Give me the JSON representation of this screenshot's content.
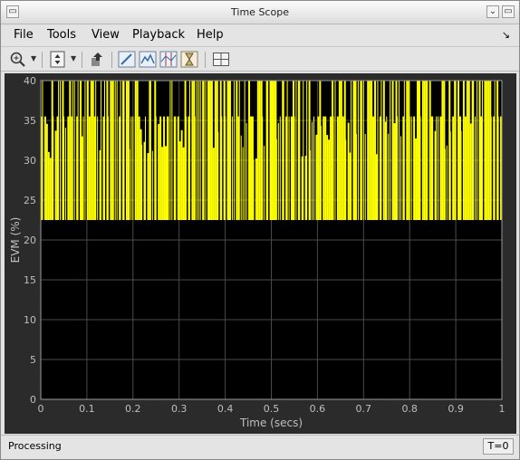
{
  "window": {
    "title": "Time Scope"
  },
  "menu": {
    "file": "File",
    "tools": "Tools",
    "view": "View",
    "playback": "Playback",
    "help": "Help"
  },
  "status": {
    "left": "Processing",
    "time": "T=0"
  },
  "colors": {
    "plot_bg": "#000000",
    "figure_bg": "#2b2b2b",
    "trace": "#ffff00",
    "grid": "#4a4a4a",
    "tick_text": "#bfbfbf"
  },
  "chart_data": {
    "type": "line",
    "title": "",
    "xlabel": "Time (secs)",
    "ylabel": "EVM (%)",
    "xlim": [
      0,
      1
    ],
    "ylim": [
      0,
      40
    ],
    "xticks": [
      "0",
      "0.1",
      "0.2",
      "0.3",
      "0.4",
      "0.5",
      "0.6",
      "0.7",
      "0.8",
      "0.9",
      "1"
    ],
    "yticks": [
      "0",
      "5",
      "10",
      "15",
      "20",
      "25",
      "30",
      "35",
      "40"
    ],
    "grid": true,
    "series": [
      {
        "levels": [
          22.5,
          40
        ],
        "x_range": [
          0,
          1
        ],
        "description_values": [
          22.5,
          35.5,
          40
        ]
      }
    ]
  }
}
